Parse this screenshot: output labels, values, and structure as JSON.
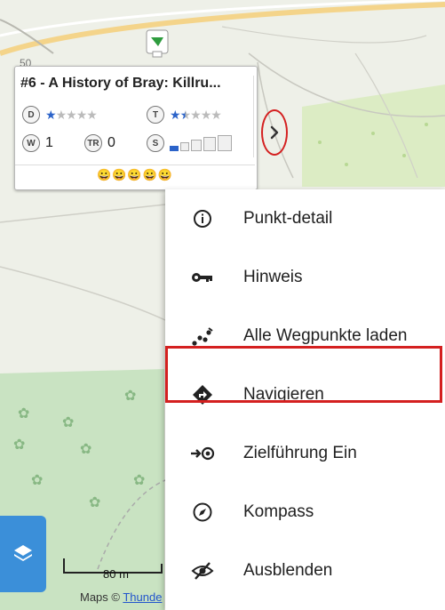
{
  "popup": {
    "title": "#6 - A History of Bray: Killru...",
    "difficulty_label": "D",
    "terrain_label": "T",
    "difficulty_stars": 1,
    "terrain_stars": 1.5,
    "waypoints_label": "W",
    "waypoints_value": "1",
    "trackables_label": "TR",
    "trackables_value": "0",
    "size_label": "S",
    "emojis": "😀😀😀😀😀",
    "star_char": "★"
  },
  "map": {
    "road_label": "50",
    "scale_label": "80 m",
    "credit_prefix": "Maps © ",
    "credit_link": "Thunde"
  },
  "menu": {
    "items": [
      {
        "label": "Punkt-detail",
        "icon": "info-icon"
      },
      {
        "label": "Hinweis",
        "icon": "key-icon"
      },
      {
        "label": "Alle Wegpunkte laden",
        "icon": "waypoints-icon"
      },
      {
        "label": "Navigieren",
        "icon": "navigate-icon"
      },
      {
        "label": "Zielführung Ein",
        "icon": "guidance-icon"
      },
      {
        "label": "Kompass",
        "icon": "compass-icon"
      },
      {
        "label": "Ausblenden",
        "icon": "hide-icon"
      }
    ]
  },
  "colors": {
    "highlight": "#d42020",
    "accent_blue": "#3b8fd9",
    "star_blue": "#2b63c9"
  }
}
